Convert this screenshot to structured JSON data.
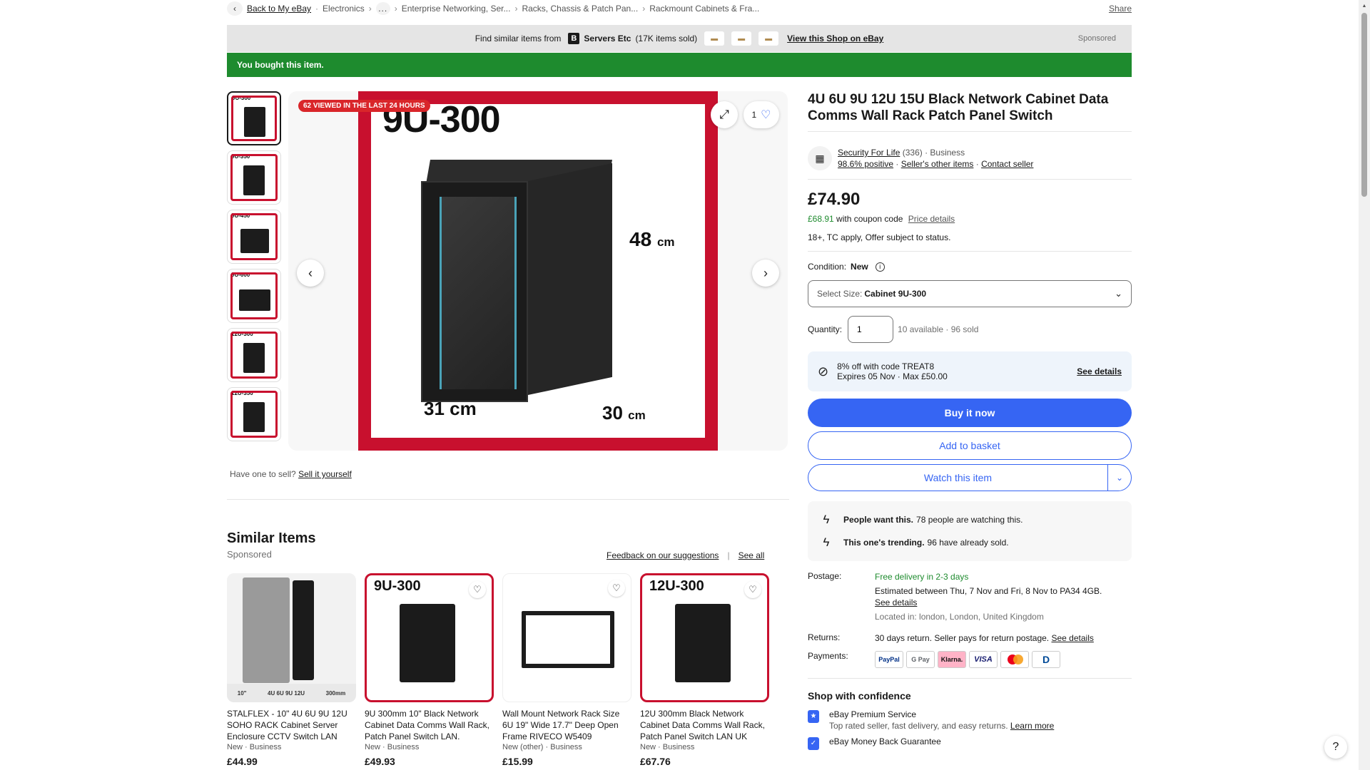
{
  "breadcrumb": {
    "back": "Back to My eBay",
    "items": [
      "Electronics",
      "Enterprise Networking, Ser...",
      "Racks, Chassis & Patch Pan...",
      "Rackmount Cabinets & Fra..."
    ],
    "dots": "...",
    "share": "Share"
  },
  "store_banner": {
    "prefix": "Find similar items from",
    "store_logo": "B",
    "store_name": "Servers Etc",
    "store_sold": "(17K items sold)",
    "view_shop": "View this Shop on eBay",
    "sponsored": "Sponsored"
  },
  "bought_banner": "You bought this item.",
  "gallery": {
    "viewed_badge": "62 VIEWED IN THE LAST 24 HOURS",
    "size_title": "9U-300",
    "dim_height": "48",
    "dim_width": "31 cm",
    "dim_depth": "30",
    "dim_unit": "cm",
    "watch_count": "1",
    "thumbs": [
      "9U-300",
      "9U-350",
      "9U-450",
      "9U-600",
      "12U-300",
      "12U-350"
    ]
  },
  "have_one": {
    "text": "Have one to sell?",
    "link": "Sell it yourself"
  },
  "similar": {
    "title": "Similar Items",
    "sponsored": "Sponsored",
    "feedback": "Feedback on our suggestions",
    "see_all": "See all",
    "cards": [
      {
        "title": "STALFLEX - 10\" 4U 6U 9U 12U SOHO RACK Cabinet Server Enclosure CCTV Switch LAN",
        "condition": "New · Business",
        "price": "£44.99"
      },
      {
        "title": "9U 300mm 10\" Black Network Cabinet Data Comms Wall Rack, Patch Panel Switch LAN.",
        "condition": "New · Business",
        "price": "£49.93",
        "img_label": "9U-300"
      },
      {
        "title": "Wall Mount Network Rack Size 6U 19\" Wide 17.7\" Deep Open Frame RIVECO W5409",
        "condition": "New (other) · Business",
        "price": "£15.99"
      },
      {
        "title": "12U 300mm Black Network Cabinet Data Comms Wall Rack, Patch Panel Switch LAN UK",
        "condition": "New · Business",
        "price": "£67.76",
        "img_label": "12U-300"
      }
    ],
    "stalflex_stripe": [
      "10\"",
      "4U 6U 9U 12U",
      "300mm"
    ]
  },
  "product": {
    "title": "4U 6U 9U 12U 15U Black Network Cabinet Data Comms Wall Rack Patch Panel Switch",
    "seller_name": "Security For Life",
    "seller_count": "(336)",
    "seller_type": "· Business",
    "positive": "98.6% positive",
    "other_items": "Seller's other items",
    "contact": "Contact seller",
    "price": "£74.90",
    "coupon_price": "£68.91",
    "coupon_text": "with coupon code",
    "price_details": "Price details",
    "offer_note": "18+, TC apply, Offer subject to status.",
    "condition_label": "Condition:",
    "condition_value": "New",
    "select_label": "Select Size:",
    "select_value": "Cabinet 9U-300",
    "qty_label": "Quantity:",
    "qty_value": "1",
    "qty_avail": "10 available · 96 sold",
    "coupon_line1": "8% off with code TREAT8",
    "coupon_line2": "Expires 05 Nov · Max £50.00",
    "coupon_see": "See details",
    "buy_now": "Buy it now",
    "add_basket": "Add to basket",
    "watch": "Watch this item",
    "signal1_bold": "People want this.",
    "signal1_text": "78 people are watching this.",
    "signal2_bold": "This one's trending.",
    "signal2_text": "96 have already sold.",
    "postage_label": "Postage:",
    "postage_free": "Free delivery in 2-3 days",
    "postage_est": "Estimated between Thu, 7 Nov and Fri, 8 Nov to PA34 4GB.",
    "postage_see": "See details",
    "postage_loc": "Located in: london, London, United Kingdom",
    "returns_label": "Returns:",
    "returns_text": "30 days return. Seller pays for return postage.",
    "returns_see": "See details",
    "payments_label": "Payments:",
    "pay_paypal": "PayPal",
    "pay_gpay": "G Pay",
    "pay_klarna": "Klarna.",
    "pay_visa": "VISA",
    "pay_diners": "D",
    "shop_confidence": "Shop with confidence",
    "premium_title": "eBay Premium Service",
    "premium_sub": "Top rated seller, fast delivery, and easy returns.",
    "learn_more": "Learn more",
    "mbg": "eBay Money Back Guarantee"
  },
  "help": "?"
}
